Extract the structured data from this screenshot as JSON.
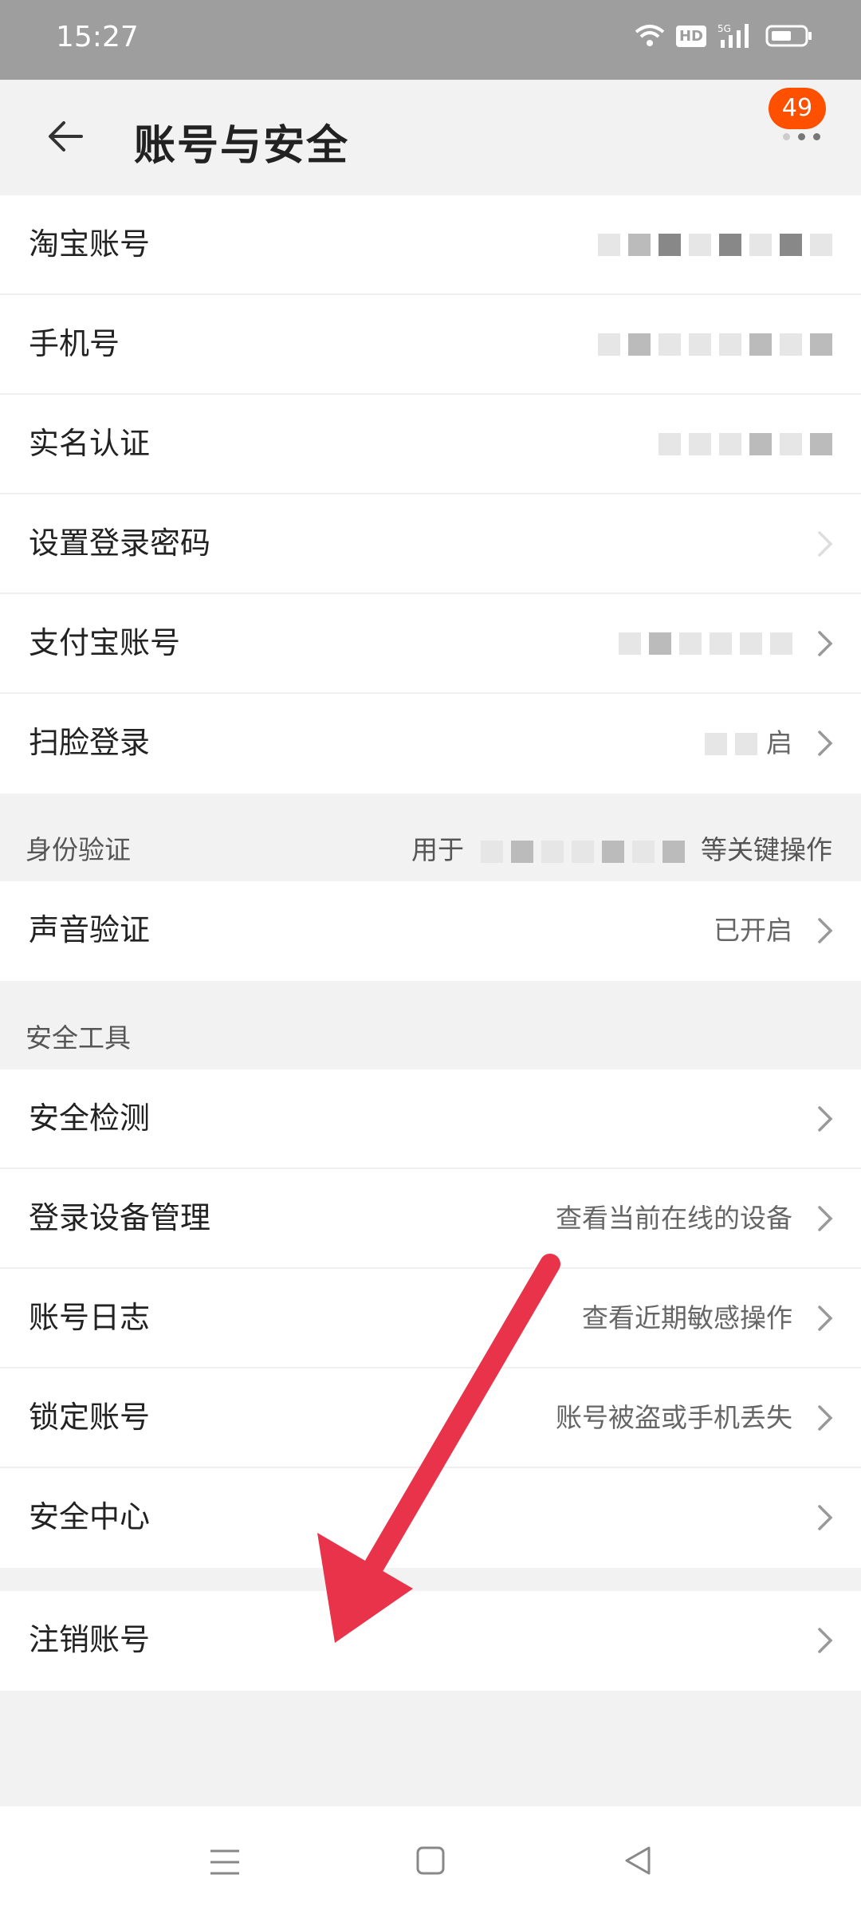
{
  "status_bar": {
    "time": "15:27",
    "hd_label": "HD",
    "network": "5G",
    "icons": [
      "wifi-icon",
      "hd-icon",
      "signal-icon",
      "battery-icon"
    ]
  },
  "header": {
    "title": "账号与安全",
    "badge_count": "49",
    "back_icon": "arrow-left-icon",
    "more_icon": "more-dots-icon"
  },
  "account_group": [
    {
      "label": "淘宝账号",
      "value": "",
      "masked": true,
      "chevron": false
    },
    {
      "label": "手机号",
      "value": "",
      "masked": true,
      "chevron": false
    },
    {
      "label": "实名认证",
      "value": "",
      "masked": true,
      "chevron": false
    },
    {
      "label": "设置登录密码",
      "value": "",
      "masked": false,
      "chevron": true
    },
    {
      "label": "支付宝账号",
      "value": "",
      "masked": true,
      "chevron": true
    },
    {
      "label": "扫脸登录",
      "value": "启",
      "masked": true,
      "chevron": true
    }
  ],
  "identity_section": {
    "title": "身份验证",
    "note_prefix": "用于",
    "note_suffix": "等关键操作"
  },
  "identity_group": [
    {
      "label": "声音验证",
      "value": "已开启",
      "chevron": true
    }
  ],
  "tools_section": {
    "title": "安全工具"
  },
  "tools_group": [
    {
      "label": "安全检测",
      "value": "",
      "chevron": true
    },
    {
      "label": "登录设备管理",
      "value": "查看当前在线的设备",
      "chevron": true
    },
    {
      "label": "账号日志",
      "value": "查看近期敏感操作",
      "chevron": true
    },
    {
      "label": "锁定账号",
      "value": "账号被盗或手机丢失",
      "chevron": true
    },
    {
      "label": "安全中心",
      "value": "",
      "chevron": true
    }
  ],
  "cancel_group": [
    {
      "label": "注销账号",
      "value": "",
      "chevron": true
    }
  ],
  "nav_bar": {
    "icons": [
      "menu-icon",
      "home-square-icon",
      "back-triangle-icon"
    ]
  },
  "annotation": {
    "arrow_color": "#e8334a"
  }
}
